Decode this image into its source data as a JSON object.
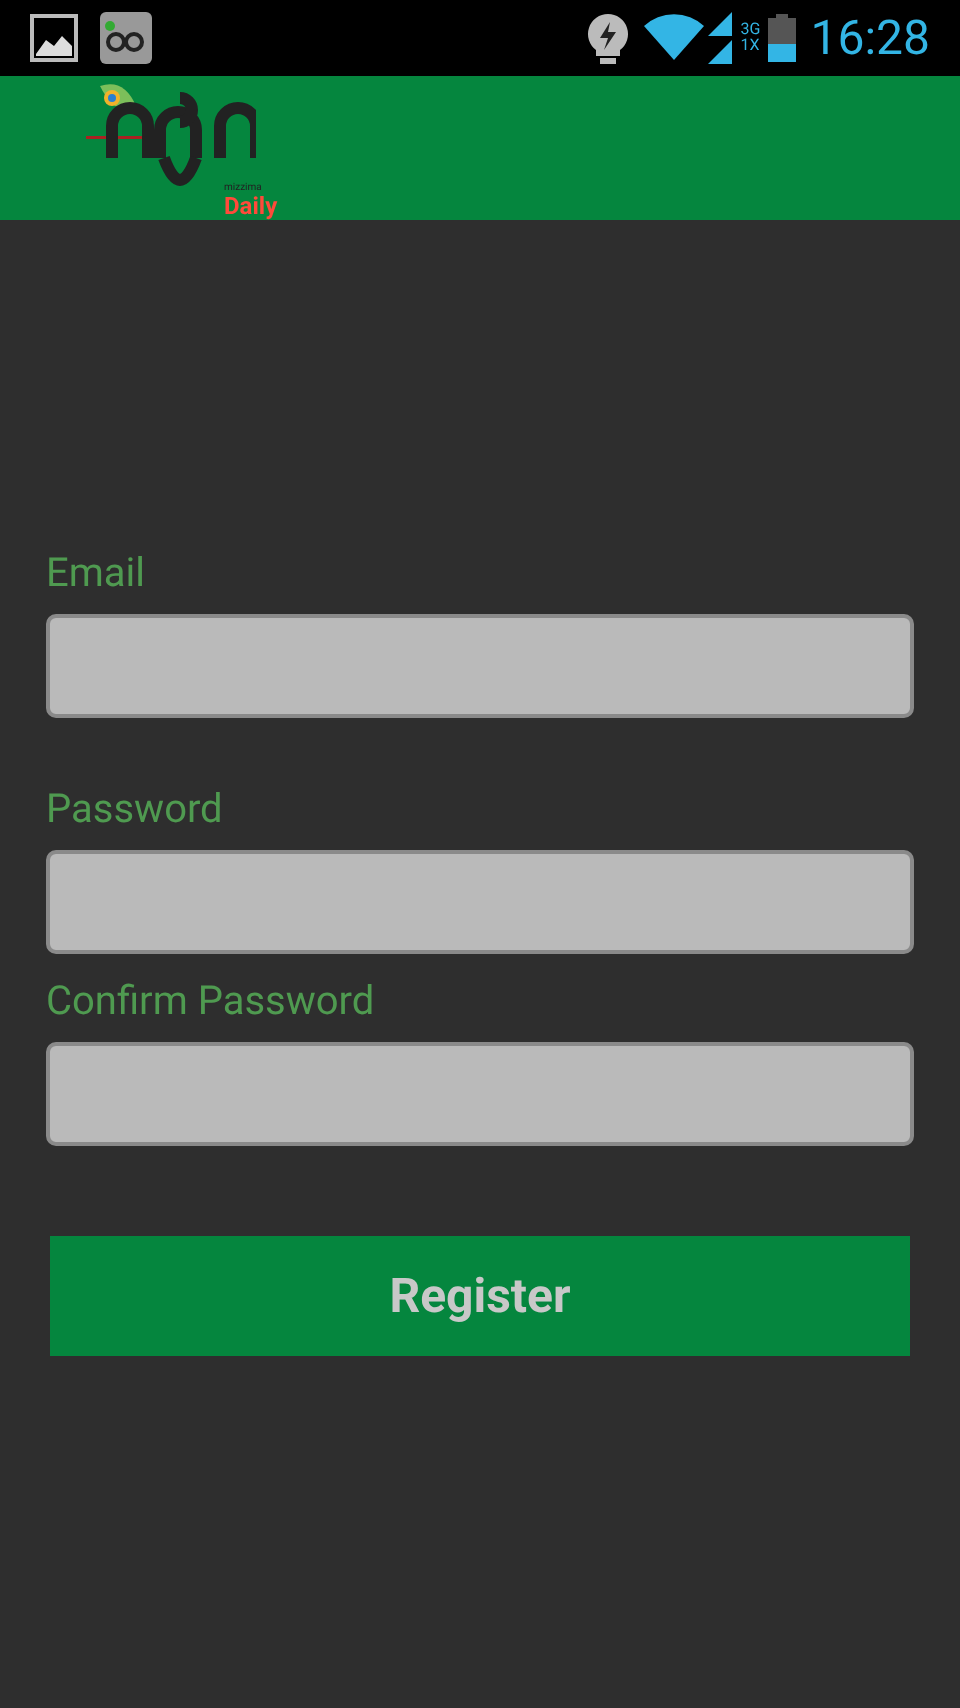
{
  "status_bar": {
    "time": "16:28",
    "network_labels": [
      "3G",
      "1X"
    ]
  },
  "app_bar": {
    "logo_caption": "mizzima",
    "logo_subtitle": "Daily"
  },
  "form": {
    "fields": [
      {
        "label": "Email"
      },
      {
        "label": "Password"
      },
      {
        "label": "Confirm Password"
      }
    ],
    "submit": "Register"
  }
}
